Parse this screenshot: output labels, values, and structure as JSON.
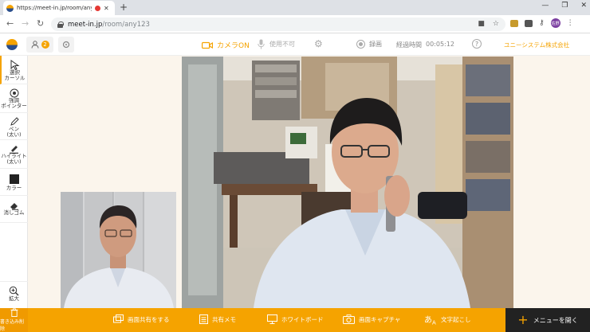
{
  "browser": {
    "tab_title": "https://meet-in.jp/room/any",
    "url_host": "meet-in.jp",
    "url_path": "/room/any123",
    "profile_initials": "佐野"
  },
  "toolbar": {
    "participants_count": "2",
    "camera_label": "カメラON",
    "mic_label": "使用不可",
    "record_label": "録画",
    "elapsed_label": "経過時間",
    "elapsed_value": "00:05:12",
    "company_name": "ユニーシステム株式会社"
  },
  "left_tools": [
    {
      "label": "選択\nカーソル"
    },
    {
      "label": "強調\nポインター"
    },
    {
      "label": "ペン\n(太い)"
    },
    {
      "label": "ハイライト\n(太い)"
    },
    {
      "label": "カラー"
    },
    {
      "label": "消しゴム"
    },
    {
      "label": "拡大"
    }
  ],
  "bottom": {
    "trash_label": "書き込み削除",
    "screen_share": "画面共有をする",
    "memo": "共有メモ",
    "whiteboard": "ホワイトボード",
    "capture": "画面キャプチャ",
    "transcribe": "文字起こし",
    "menu_open": "メニューを開く"
  },
  "colors": {
    "accent": "#f5a300",
    "brand_blue": "#2a4e8c",
    "stage_bg": "#fbf5ec"
  }
}
